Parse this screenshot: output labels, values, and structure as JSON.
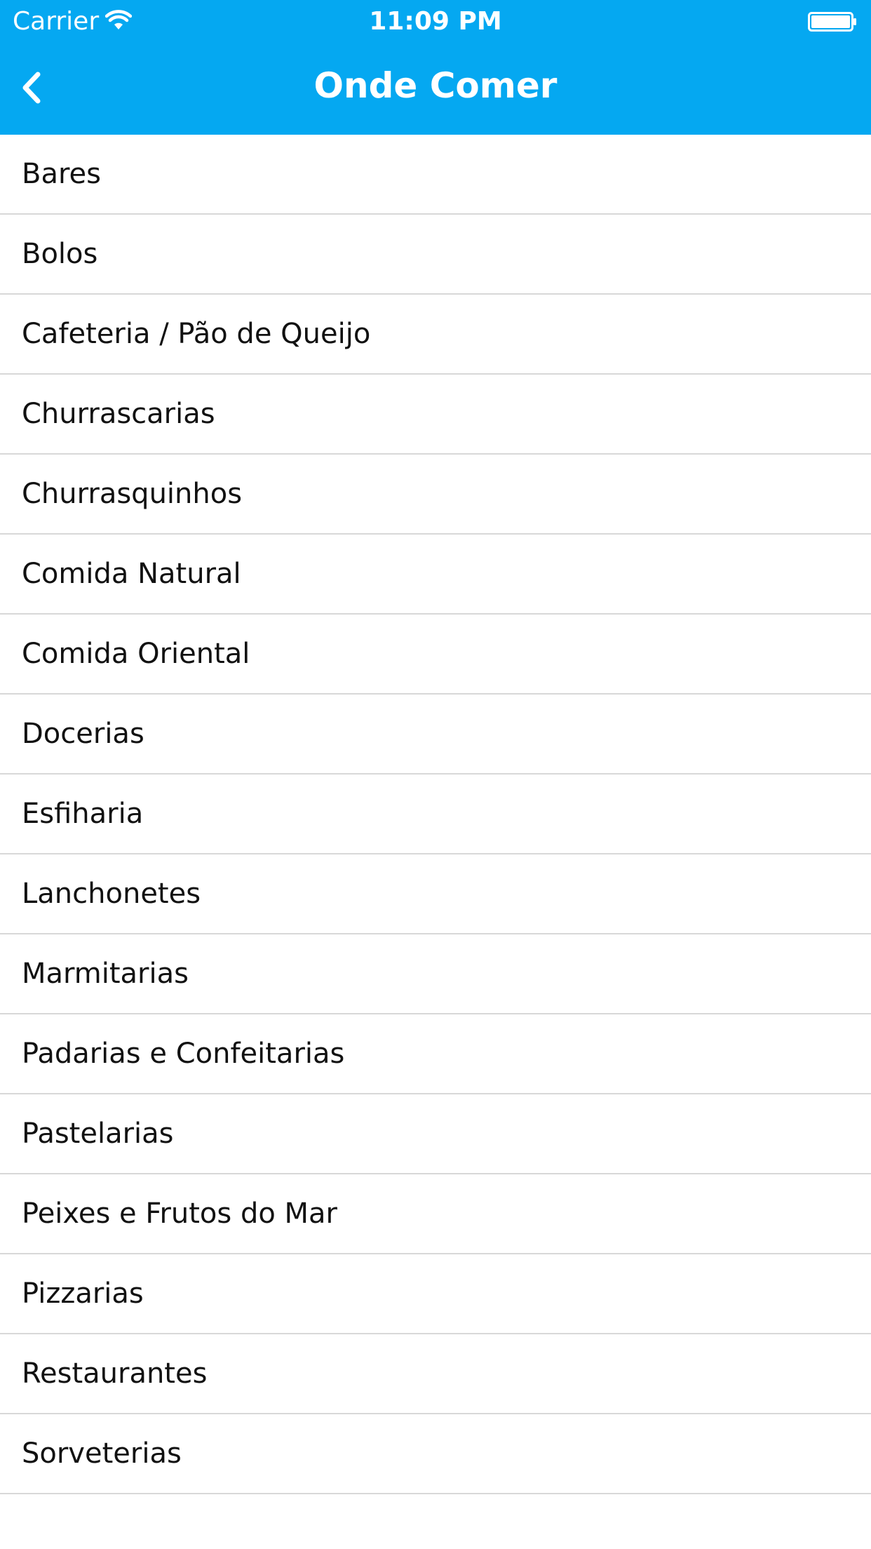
{
  "status_bar": {
    "carrier": "Carrier",
    "time": "11:09 PM"
  },
  "nav": {
    "title": "Onde Comer",
    "back_icon": "chevron-left-icon"
  },
  "colors": {
    "header": "#05a8f1",
    "divider": "#d8d8d8",
    "text": "#111111"
  },
  "categories": [
    {
      "label": "Bares"
    },
    {
      "label": "Bolos"
    },
    {
      "label": "Cafeteria / Pão de Queijo"
    },
    {
      "label": "Churrascarias"
    },
    {
      "label": "Churrasquinhos"
    },
    {
      "label": "Comida Natural"
    },
    {
      "label": "Comida Oriental"
    },
    {
      "label": "Docerias"
    },
    {
      "label": "Esfiharia"
    },
    {
      "label": "Lanchonetes"
    },
    {
      "label": "Marmitarias"
    },
    {
      "label": "Padarias e Confeitarias"
    },
    {
      "label": "Pastelarias"
    },
    {
      "label": "Peixes e Frutos do Mar"
    },
    {
      "label": "Pizzarias"
    },
    {
      "label": "Restaurantes"
    },
    {
      "label": "Sorveterias"
    }
  ]
}
